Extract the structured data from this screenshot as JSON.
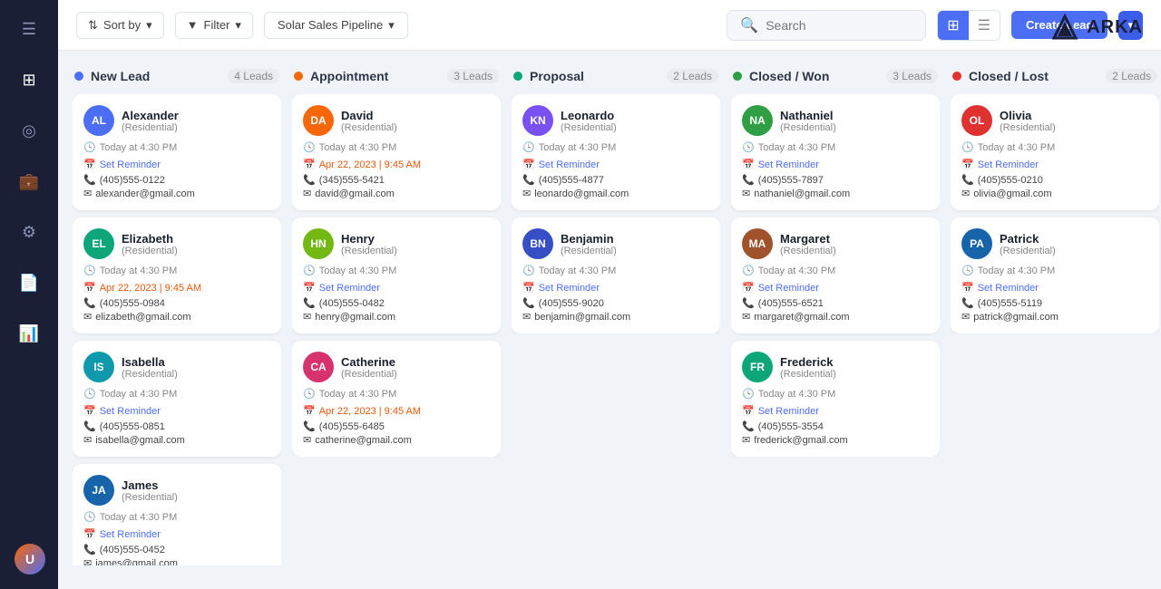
{
  "logo": {
    "text": "ARKA"
  },
  "topbar": {
    "sort_label": "Sort by",
    "filter_label": "Filter",
    "pipeline_label": "Solar Sales Pipeline",
    "search_placeholder": "Search",
    "create_lead_label": "Create Lead"
  },
  "columns": [
    {
      "id": "new-lead",
      "title": "New Lead",
      "count": "4 Leads",
      "dot_color": "#4c6ef5",
      "cards": [
        {
          "name": "Alexander",
          "type": "Residential",
          "initials": "AL",
          "avatar_class": "av-blue",
          "time": "Today at 4:30 PM",
          "has_reminder": true,
          "reminder_label": "Set Reminder",
          "phone": "(405)555-0122",
          "email": "alexander@gmail.com",
          "appointment": null
        },
        {
          "name": "Elizabeth",
          "type": "Residential",
          "initials": "EL",
          "avatar_class": "av-teal",
          "time": "Today at 4:30 PM",
          "has_reminder": false,
          "appointment": "Apr 22, 2023  |  9:45 AM",
          "phone": "(405)555-0984",
          "email": "elizabeth@gmail.com",
          "reminder_label": "Set Reminder"
        },
        {
          "name": "Isabella",
          "type": "Residential",
          "initials": "IS",
          "avatar_class": "av-cyan",
          "time": "Today at 4:30 PM",
          "has_reminder": true,
          "reminder_label": "Set Reminder",
          "phone": "(405)555-0851",
          "email": "isabella@gmail.com",
          "appointment": null
        },
        {
          "name": "James",
          "type": "Residential",
          "initials": "JA",
          "avatar_class": "av-navy",
          "time": "Today at 4:30 PM",
          "has_reminder": true,
          "reminder_label": "Set Reminder",
          "phone": "(405)555-0452",
          "email": "james@gmail.com",
          "appointment": null
        }
      ]
    },
    {
      "id": "appointment",
      "title": "Appointment",
      "count": "3 Leads",
      "dot_color": "#f76707",
      "cards": [
        {
          "name": "David",
          "type": "Residential",
          "initials": "DA",
          "avatar_class": "av-orange",
          "time": "Today at 4:30 PM",
          "has_reminder": false,
          "appointment": "Apr 22, 2023  |  9:45 AM",
          "reminder_label": "Set Reminder",
          "phone": "(345)555-5421",
          "email": "david@gmail.com"
        },
        {
          "name": "Henry",
          "type": "Residential",
          "initials": "HN",
          "avatar_class": "av-lime",
          "time": "Today at 4:30 PM",
          "has_reminder": true,
          "reminder_label": "Set Reminder",
          "phone": "(405)555-0482",
          "email": "henry@gmail.com",
          "appointment": null
        },
        {
          "name": "Catherine",
          "type": "Residential",
          "initials": "CA",
          "avatar_class": "av-pink",
          "time": "Today at 4:30 PM",
          "has_reminder": false,
          "appointment": "Apr 22, 2023  |  9:45 AM",
          "reminder_label": "Set Reminder",
          "phone": "(405)555-6485",
          "email": "catherine@gmail.com"
        }
      ]
    },
    {
      "id": "proposal",
      "title": "Proposal",
      "count": "2 Leads",
      "dot_color": "#0ca678",
      "cards": [
        {
          "name": "Leonardo",
          "type": "Residential",
          "initials": "KN",
          "avatar_class": "av-purple",
          "time": "Today at 4:30 PM",
          "has_reminder": true,
          "reminder_label": "Set Reminder",
          "phone": "(405)555-4877",
          "email": "leonardo@gmail.com",
          "appointment": null
        },
        {
          "name": "Benjamin",
          "type": "Residential",
          "initials": "BN",
          "avatar_class": "av-indigo",
          "time": "Today at 4:30 PM",
          "has_reminder": true,
          "reminder_label": "Set Reminder",
          "phone": "(405)555-9020",
          "email": "benjamin@gmail.com",
          "appointment": null
        }
      ]
    },
    {
      "id": "closed-won",
      "title": "Closed / Won",
      "count": "3 Leads",
      "dot_color": "#2f9e44",
      "cards": [
        {
          "name": "Nathaniel",
          "type": "Residential",
          "initials": "NA",
          "avatar_class": "av-green",
          "time": "Today at 4:30 PM",
          "has_reminder": true,
          "reminder_label": "Set Reminder",
          "phone": "(405)555-7897",
          "email": "nathaniel@gmail.com",
          "appointment": null
        },
        {
          "name": "Margaret",
          "type": "Residential",
          "initials": "MA",
          "avatar_class": "av-brown",
          "time": "Today at 4:30 PM",
          "has_reminder": true,
          "reminder_label": "Set Reminder",
          "phone": "(405)555-6521",
          "email": "margaret@gmail.com",
          "appointment": null
        },
        {
          "name": "Frederick",
          "type": "Residential",
          "initials": "FR",
          "avatar_class": "av-teal",
          "time": "Today at 4:30 PM",
          "has_reminder": true,
          "reminder_label": "Set Reminder",
          "phone": "(405)555-3554",
          "email": "frederick@gmail.com",
          "appointment": null
        }
      ]
    },
    {
      "id": "closed-lost",
      "title": "Closed / Lost",
      "count": "2 Leads",
      "dot_color": "#e03131",
      "cards": [
        {
          "name": "Olivia",
          "type": "Residential",
          "initials": "OL",
          "avatar_class": "av-red",
          "time": "Today at 4:30 PM",
          "has_reminder": true,
          "reminder_label": "Set Reminder",
          "phone": "(405)555-0210",
          "email": "olivia@gmail.com",
          "appointment": null
        },
        {
          "name": "Patrick",
          "type": "Residential",
          "initials": "PA",
          "avatar_class": "av-navy",
          "time": "Today at 4:30 PM",
          "has_reminder": true,
          "reminder_label": "Set Reminder",
          "phone": "(405)555-5119",
          "email": "patrick@gmail.com",
          "appointment": null
        }
      ]
    }
  ],
  "user": {
    "initials": "U"
  }
}
